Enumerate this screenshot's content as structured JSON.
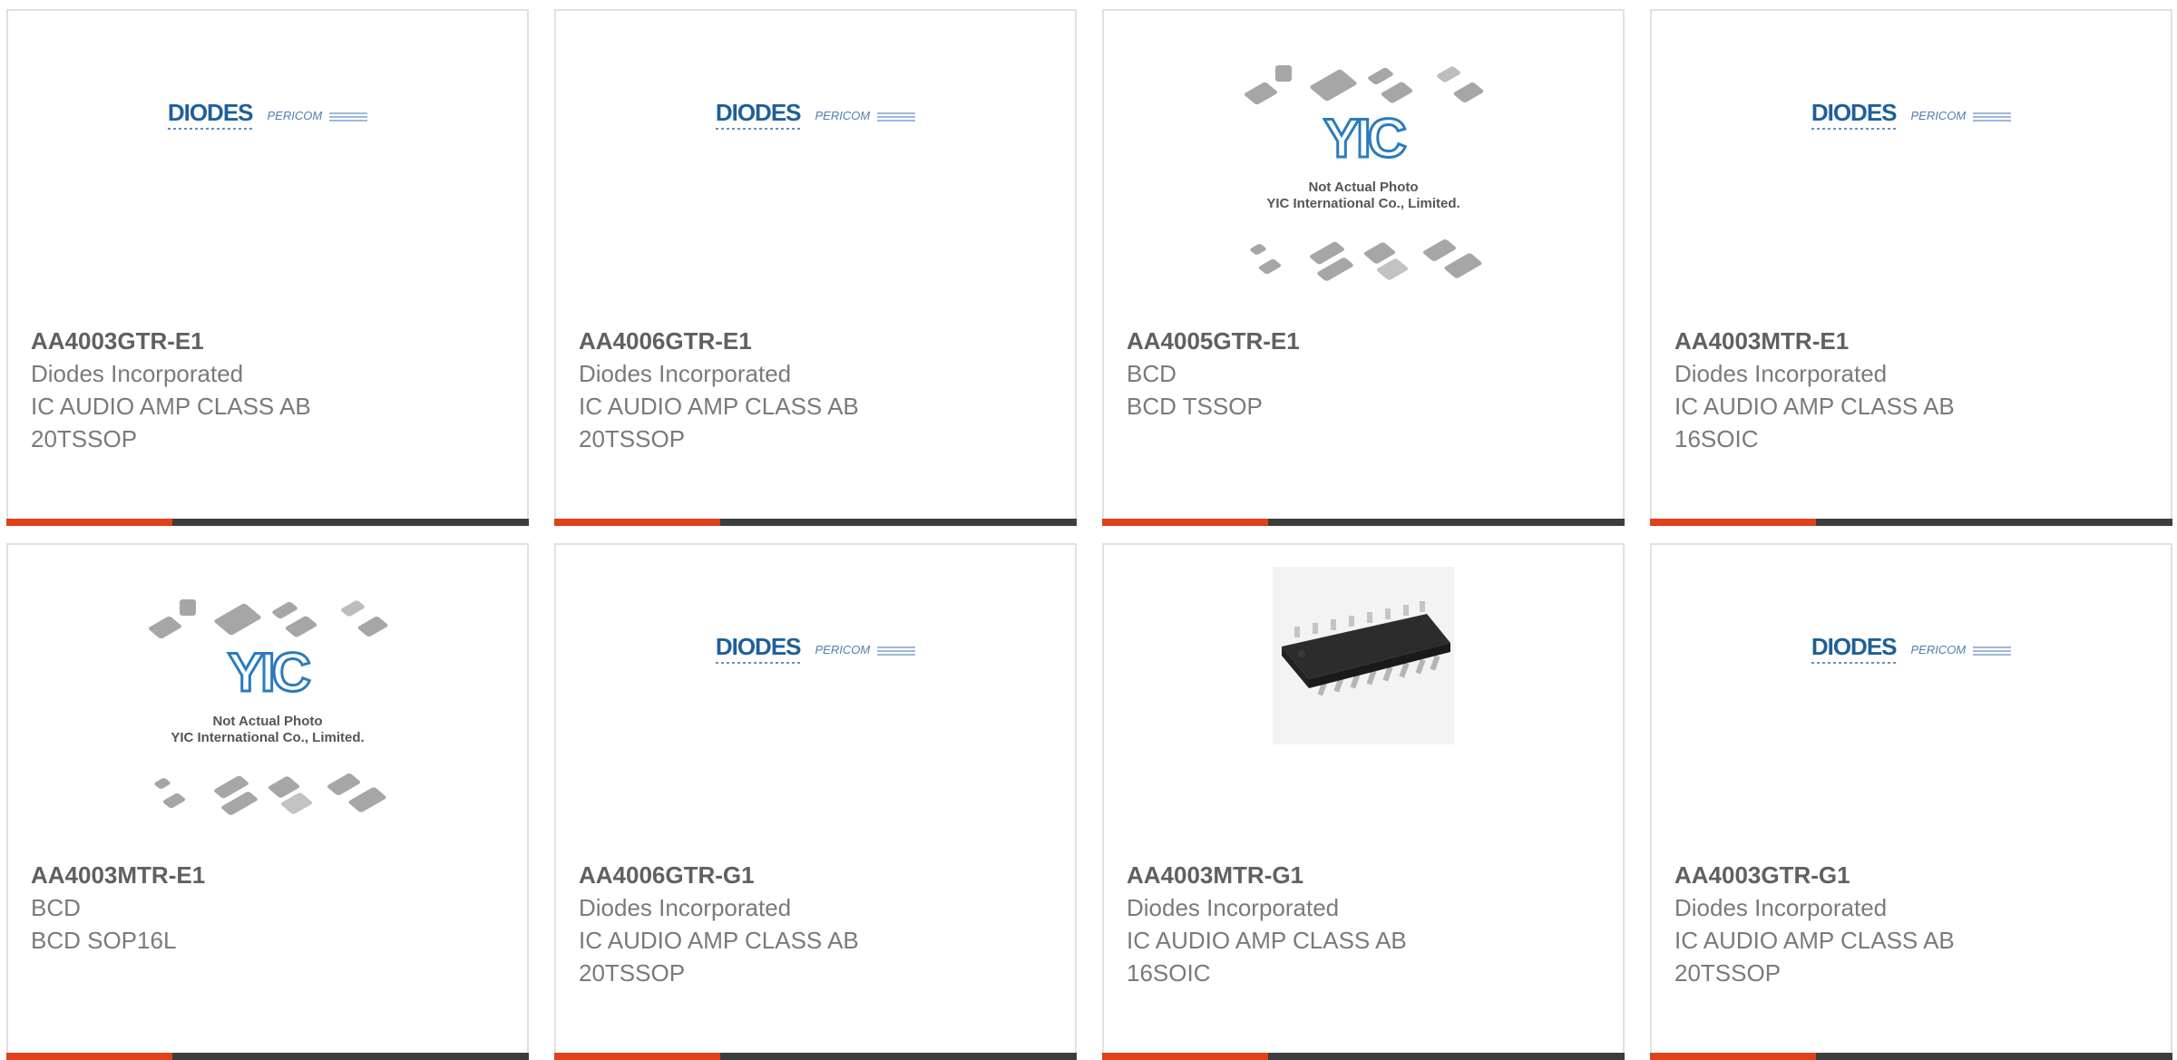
{
  "products": [
    {
      "part": "AA4003GTR-E1",
      "mfr": "Diodes Incorporated",
      "desc1": "IC AUDIO AMP CLASS AB",
      "desc2": "20TSSOP",
      "image": "diodes-pericom-logo",
      "brand": "DIODES",
      "brand2": "PERICOM"
    },
    {
      "part": "AA4006GTR-E1",
      "mfr": "Diodes Incorporated",
      "desc1": "IC AUDIO AMP CLASS AB",
      "desc2": "20TSSOP",
      "image": "diodes-pericom-logo",
      "brand": "DIODES",
      "brand2": "PERICOM"
    },
    {
      "part": "AA4005GTR-E1",
      "mfr": "BCD",
      "desc1": "BCD TSSOP",
      "desc2": "",
      "image": "yic-not-actual-photo",
      "mark": "YIC",
      "caption1": "Not Actual Photo",
      "caption2": "YIC International Co., Limited."
    },
    {
      "part": "AA4003MTR-E1",
      "mfr": "Diodes Incorporated",
      "desc1": "IC AUDIO AMP CLASS AB",
      "desc2": "16SOIC",
      "image": "diodes-pericom-logo",
      "brand": "DIODES",
      "brand2": "PERICOM"
    },
    {
      "part": "AA4003MTR-E1",
      "mfr": "BCD",
      "desc1": "BCD SOP16L",
      "desc2": "",
      "image": "yic-not-actual-photo",
      "mark": "YIC",
      "caption1": "Not Actual Photo",
      "caption2": "YIC International Co., Limited."
    },
    {
      "part": "AA4006GTR-G1",
      "mfr": "Diodes Incorporated",
      "desc1": "IC AUDIO AMP CLASS AB",
      "desc2": "20TSSOP",
      "image": "diodes-pericom-logo",
      "brand": "DIODES",
      "brand2": "PERICOM"
    },
    {
      "part": "AA4003MTR-G1",
      "mfr": "Diodes Incorporated",
      "desc1": "IC AUDIO AMP CLASS AB",
      "desc2": "16SOIC",
      "image": "soic16-package-photo"
    },
    {
      "part": "AA4003GTR-G1",
      "mfr": "Diodes Incorporated",
      "desc1": "IC AUDIO AMP CLASS AB",
      "desc2": "20TSSOP",
      "image": "diodes-pericom-logo",
      "brand": "DIODES",
      "brand2": "PERICOM"
    }
  ],
  "colors": {
    "accent": "#e0401a",
    "bar": "#3d3d3d",
    "border": "#e1e1e1",
    "part_text": "#606060",
    "body_text": "#7a7a7a",
    "diodes_blue": "#1f5f9a",
    "yic_blue": "#2a7bbf"
  }
}
